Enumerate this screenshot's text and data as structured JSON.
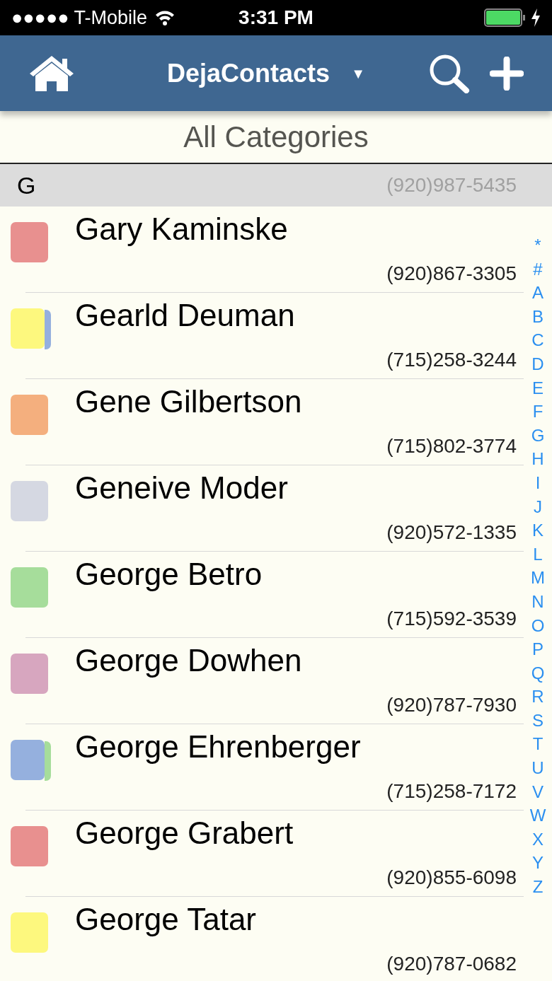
{
  "status_bar": {
    "carrier": "●●●●● T-Mobile",
    "time": "3:31 PM"
  },
  "nav": {
    "title": "DejaContacts",
    "dropdown": "▼"
  },
  "subtitle": "All Categories",
  "section": {
    "letter": "G",
    "phone": "(920)987-5435"
  },
  "contacts": [
    {
      "name": "Gary Kaminske",
      "phone": "(920)867-3305",
      "categories": [
        {
          "color": "#e8908f"
        }
      ]
    },
    {
      "name": "Gearld Deuman",
      "phone": "(715)258-3244",
      "categories": [
        {
          "color": "#fdf87e"
        },
        {
          "color": "#95b0de"
        }
      ]
    },
    {
      "name": "Gene Gilbertson",
      "phone": "(715)802-3774",
      "categories": [
        {
          "color": "#f4af7e"
        }
      ]
    },
    {
      "name": "Geneive Moder",
      "phone": "(920)572-1335",
      "categories": [
        {
          "color": "#d5d8e2"
        }
      ]
    },
    {
      "name": "George Betro",
      "phone": "(715)592-3539",
      "categories": [
        {
          "color": "#a6dd9b"
        }
      ]
    },
    {
      "name": "George Dowhen",
      "phone": "(920)787-7930",
      "categories": [
        {
          "color": "#d7a6bf"
        }
      ]
    },
    {
      "name": "George Ehrenberger",
      "phone": "(715)258-7172",
      "categories": [
        {
          "color": "#95b0de"
        },
        {
          "color": "#a6dd9b"
        }
      ]
    },
    {
      "name": "George Grabert",
      "phone": "(920)855-6098",
      "categories": [
        {
          "color": "#e8908f"
        }
      ]
    },
    {
      "name": "George Tatar",
      "phone": "(920)787-0682",
      "categories": [
        {
          "color": "#fdf87e"
        }
      ]
    }
  ],
  "index": [
    "*",
    "#",
    "A",
    "B",
    "C",
    "D",
    "E",
    "F",
    "G",
    "H",
    "I",
    "J",
    "K",
    "L",
    "M",
    "N",
    "O",
    "P",
    "Q",
    "R",
    "S",
    "T",
    "U",
    "V",
    "W",
    "X",
    "Y",
    "Z"
  ]
}
